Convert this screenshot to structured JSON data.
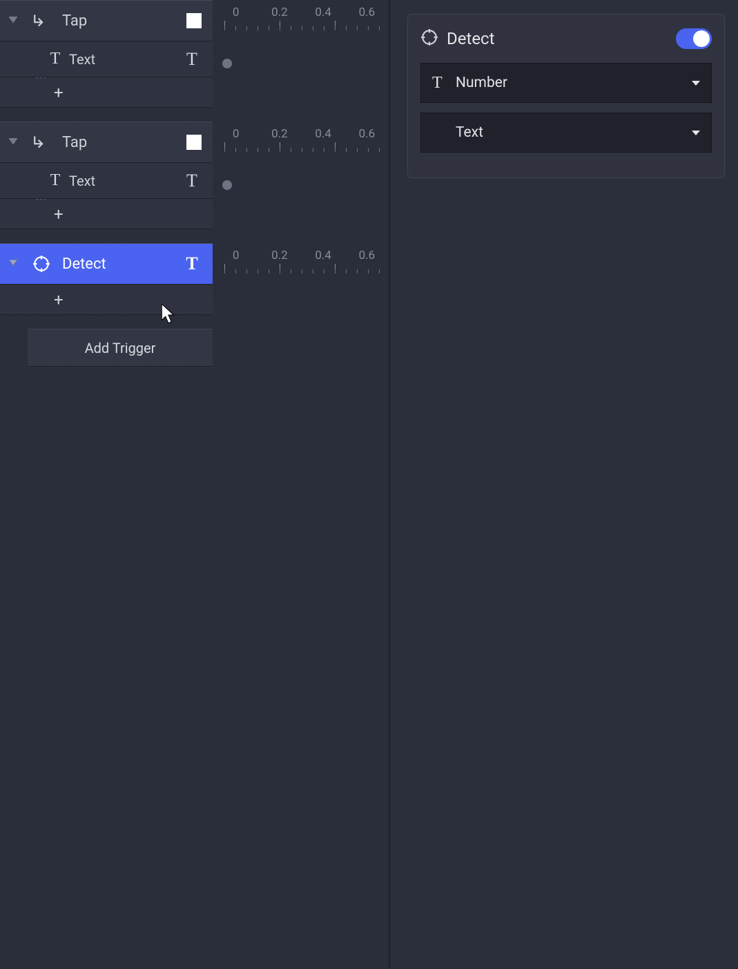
{
  "colors": {
    "accent": "#4a63f0",
    "swatch": "#ffffff"
  },
  "ruler": {
    "ticks": [
      "0",
      "0.2",
      "0.4",
      "0.6"
    ]
  },
  "triggers": [
    {
      "name": "Tap",
      "icon": "tap",
      "type_hint": "swatch",
      "children": [
        {
          "label": "Text",
          "icon": "T",
          "type": "T"
        }
      ],
      "selected": false
    },
    {
      "name": "Tap",
      "icon": "tap",
      "type_hint": "swatch",
      "children": [
        {
          "label": "Text",
          "icon": "T",
          "type": "T"
        }
      ],
      "selected": false
    },
    {
      "name": "Detect",
      "icon": "detect",
      "type_hint": "T",
      "children": [],
      "selected": true
    }
  ],
  "add_trigger_label": "Add Trigger",
  "inspector": {
    "title": "Detect",
    "toggle_on": true,
    "rows": [
      {
        "icon": "T",
        "label": "Number"
      },
      {
        "icon": "",
        "label": "Text"
      }
    ]
  }
}
